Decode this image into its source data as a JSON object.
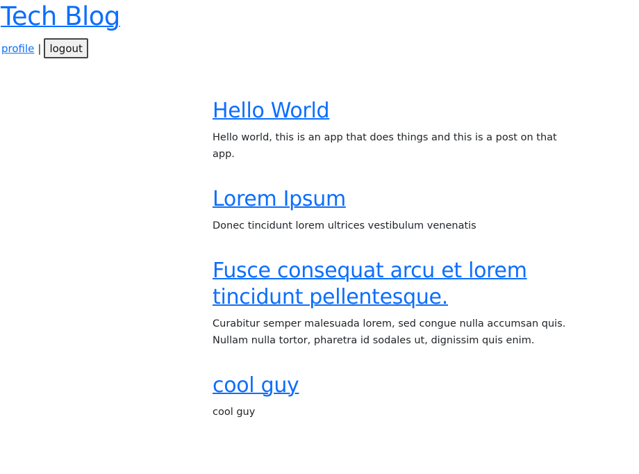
{
  "header": {
    "title": "Tech Blog",
    "nav": {
      "profile_label": "profile",
      "separator": "|",
      "logout_label": "logout"
    }
  },
  "posts": [
    {
      "title": "Hello World",
      "body": "Hello world, this is an app that does things and this is a post on that app."
    },
    {
      "title": "Lorem Ipsum",
      "body": "Donec tincidunt lorem ultrices vestibulum venenatis"
    },
    {
      "title": "Fusce consequat arcu et lorem tincidunt pellentesque.",
      "body": "Curabitur semper malesuada lorem, sed congue nulla accumsan quis. Nullam nulla tortor, pharetra id sodales ut, dignissim quis enim."
    },
    {
      "title": "cool guy",
      "body": "cool guy"
    }
  ],
  "colors": {
    "link": "#0d6efd",
    "text": "#212529"
  }
}
